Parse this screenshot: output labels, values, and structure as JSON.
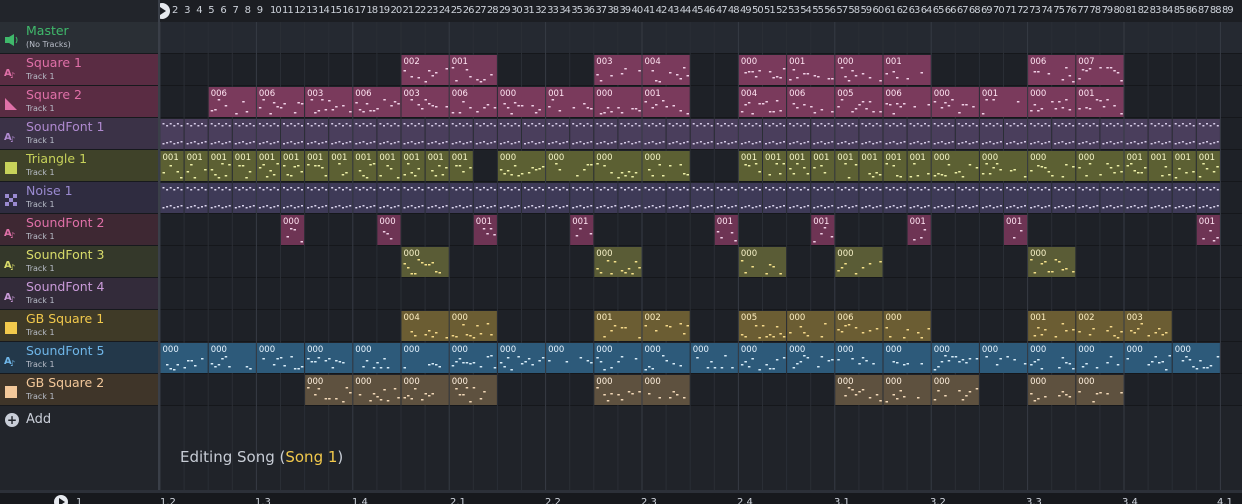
{
  "tracks": [
    {
      "name": "Master",
      "sub": "(No Tracks)",
      "icon": "speaker-icon",
      "color": "#3fb96b",
      "bg": "#2a2f35"
    },
    {
      "name": "Square 1",
      "sub": "Track 1",
      "icon": "soundfont-icon",
      "color": "#e070a8",
      "bg": "#5a2c43"
    },
    {
      "name": "Square 2",
      "sub": "Track 1",
      "icon": "ramp-icon",
      "color": "#e070a8",
      "bg": "#5a2c43"
    },
    {
      "name": "SoundFont 1",
      "sub": "Track 1",
      "icon": "soundfont-icon",
      "color": "#b08ad0",
      "bg": "#3b3247"
    },
    {
      "name": "Triangle 1",
      "sub": "Track 1",
      "icon": "square-icon",
      "color": "#c7d25a",
      "bg": "#3f4229"
    },
    {
      "name": "Noise 1",
      "sub": "Track 1",
      "icon": "checker-icon",
      "color": "#9a8ad0",
      "bg": "#2f2c40"
    },
    {
      "name": "SoundFont 2",
      "sub": "Track 1",
      "icon": "soundfont-icon",
      "color": "#e070a8",
      "bg": "#3e2833"
    },
    {
      "name": "SoundFont 3",
      "sub": "Track 1",
      "icon": "soundfont-icon",
      "color": "#d8db6a",
      "bg": "#34382a"
    },
    {
      "name": "SoundFont 4",
      "sub": "Track 1",
      "icon": "soundfont-icon",
      "color": "#c99ad8",
      "bg": "#332b3a"
    },
    {
      "name": "GB Square 1",
      "sub": "Track 1",
      "icon": "square-icon",
      "color": "#f2c94c",
      "bg": "#3f3a27"
    },
    {
      "name": "SoundFont 5",
      "sub": "Track 1",
      "icon": "soundfont-icon",
      "color": "#6fb6e8",
      "bg": "#23384a"
    },
    {
      "name": "GB Square 2",
      "sub": "Track 1",
      "icon": "square-icon",
      "color": "#f3c89a",
      "bg": "#3f3529"
    }
  ],
  "add_label": "Add",
  "ruler_numbers": [
    "2",
    "3",
    "4",
    "5",
    "6",
    "7",
    "8",
    "9",
    "10",
    "11",
    "12",
    "13",
    "14",
    "15",
    "16",
    "17",
    "18",
    "19",
    "20",
    "21",
    "22",
    "23",
    "24",
    "25",
    "26",
    "27",
    "28",
    "29",
    "30",
    "31",
    "32",
    "33",
    "34",
    "35",
    "36",
    "37",
    "38",
    "39",
    "40",
    "41",
    "42",
    "43",
    "44",
    "45",
    "46",
    "47",
    "48",
    "49",
    "50",
    "51",
    "52",
    "53",
    "54",
    "55",
    "56",
    "57",
    "58",
    "59",
    "60",
    "61",
    "62",
    "63",
    "64",
    "65",
    "66",
    "67",
    "68",
    "69",
    "70",
    "71",
    "72",
    "73",
    "74",
    "75",
    "76",
    "77",
    "78",
    "79",
    "80",
    "81",
    "82",
    "83",
    "84",
    "85",
    "86",
    "87",
    "88",
    "89"
  ],
  "status_prefix": "Editing Song (",
  "status_song": "Song 1",
  "status_suffix": ")",
  "bottom_ruler": [
    "1",
    "1.2",
    "1.3",
    "1.4",
    "2.1",
    "2.2",
    "2.3",
    "2.4",
    "3.1",
    "3.2",
    "3.3",
    "3.4",
    "4.1"
  ],
  "clips": {
    "row1": [
      [
        10,
        "002"
      ],
      [
        12,
        "001"
      ],
      [
        18,
        "003"
      ],
      [
        20,
        "004"
      ],
      [
        24,
        "000"
      ],
      [
        26,
        "001"
      ],
      [
        28,
        "000"
      ],
      [
        30,
        "001"
      ],
      [
        36,
        "006"
      ],
      [
        38,
        "007"
      ]
    ],
    "row2": [
      [
        2,
        "006"
      ],
      [
        4,
        "006"
      ],
      [
        6,
        "003"
      ],
      [
        8,
        "006"
      ],
      [
        10,
        "003"
      ],
      [
        12,
        "006"
      ],
      [
        14,
        "000"
      ],
      [
        16,
        "001"
      ],
      [
        18,
        "000"
      ],
      [
        20,
        "001"
      ],
      [
        24,
        "004"
      ],
      [
        26,
        "006"
      ],
      [
        28,
        "005"
      ],
      [
        30,
        "006"
      ],
      [
        32,
        "000"
      ],
      [
        34,
        "001"
      ],
      [
        36,
        "000"
      ],
      [
        38,
        "001"
      ]
    ],
    "row4": [
      [
        0,
        "001"
      ],
      [
        1,
        "001"
      ],
      [
        2,
        "001"
      ],
      [
        3,
        "001"
      ],
      [
        4,
        "001"
      ],
      [
        5,
        "001"
      ],
      [
        6,
        "001"
      ],
      [
        7,
        "001"
      ],
      [
        8,
        "001"
      ],
      [
        9,
        "001"
      ],
      [
        10,
        "001"
      ],
      [
        11,
        "001"
      ],
      [
        12,
        "001"
      ],
      [
        14,
        "000"
      ],
      [
        16,
        "000"
      ],
      [
        18,
        "000"
      ],
      [
        20,
        "000"
      ],
      [
        24,
        "001"
      ],
      [
        25,
        "001"
      ],
      [
        26,
        "001"
      ],
      [
        27,
        "001"
      ],
      [
        28,
        "001"
      ],
      [
        29,
        "001"
      ],
      [
        30,
        "001"
      ],
      [
        31,
        "001"
      ],
      [
        32,
        "000"
      ],
      [
        34,
        "000"
      ],
      [
        36,
        "000"
      ],
      [
        38,
        "000"
      ],
      [
        40,
        "001"
      ],
      [
        41,
        "001"
      ],
      [
        42,
        "001"
      ],
      [
        43,
        "001"
      ]
    ],
    "row6": [
      [
        5,
        "000"
      ],
      [
        9,
        "000"
      ],
      [
        13,
        "001"
      ],
      [
        17,
        "001"
      ],
      [
        23,
        "001"
      ],
      [
        27,
        "001"
      ],
      [
        31,
        "001"
      ],
      [
        35,
        "001"
      ],
      [
        43,
        "001"
      ]
    ],
    "row7": [
      [
        10,
        "000"
      ],
      [
        18,
        "000"
      ],
      [
        24,
        "000"
      ],
      [
        28,
        "000"
      ],
      [
        36,
        "000"
      ]
    ],
    "row9": [
      [
        10,
        "004"
      ],
      [
        12,
        "000"
      ],
      [
        18,
        "001"
      ],
      [
        20,
        "002"
      ],
      [
        24,
        "005"
      ],
      [
        26,
        "000"
      ],
      [
        28,
        "006"
      ],
      [
        30,
        "000"
      ],
      [
        36,
        "001"
      ],
      [
        38,
        "002"
      ],
      [
        40,
        "003"
      ]
    ],
    "row10": [
      [
        0,
        "000"
      ],
      [
        2,
        "000"
      ],
      [
        4,
        "000"
      ],
      [
        6,
        "000"
      ],
      [
        8,
        "000"
      ],
      [
        10,
        "000"
      ],
      [
        12,
        "000"
      ],
      [
        14,
        "000"
      ],
      [
        16,
        "000"
      ],
      [
        18,
        "000"
      ],
      [
        20,
        "000"
      ],
      [
        22,
        "000"
      ],
      [
        24,
        "000"
      ],
      [
        26,
        "000"
      ],
      [
        28,
        "000"
      ],
      [
        30,
        "000"
      ],
      [
        32,
        "000"
      ],
      [
        34,
        "000"
      ],
      [
        36,
        "000"
      ],
      [
        38,
        "000"
      ],
      [
        40,
        "000"
      ],
      [
        42,
        "000"
      ]
    ],
    "row11": [
      [
        6,
        "000"
      ],
      [
        8,
        "000"
      ],
      [
        10,
        "000"
      ],
      [
        12,
        "000"
      ],
      [
        18,
        "000"
      ],
      [
        20,
        "000"
      ],
      [
        28,
        "000"
      ],
      [
        30,
        "000"
      ],
      [
        32,
        "000"
      ],
      [
        36,
        "000"
      ],
      [
        38,
        "000"
      ]
    ]
  }
}
